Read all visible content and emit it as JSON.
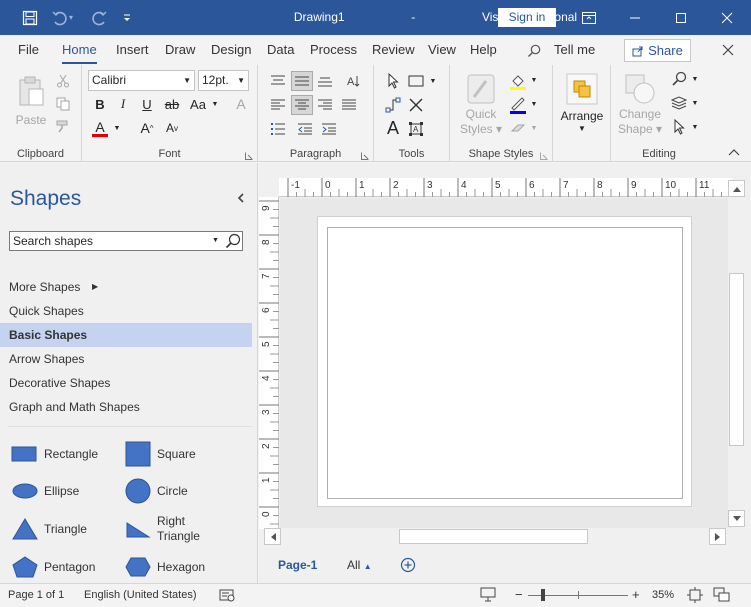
{
  "titlebar": {
    "document": "Drawing1",
    "separator": "-",
    "app": "Visio Professional",
    "sign_in": "Sign in"
  },
  "menu": {
    "tabs": [
      "File",
      "Home",
      "Insert",
      "Draw",
      "Design",
      "Data",
      "Process",
      "Review",
      "View",
      "Help"
    ],
    "active_tab": "Home",
    "tell_me": "Tell me",
    "share": "Share"
  },
  "ribbon": {
    "clipboard": {
      "paste": "Paste",
      "label": "Clipboard"
    },
    "font": {
      "family": "Calibri",
      "size": "12pt.",
      "label": "Font",
      "bold": "B",
      "italic": "I",
      "underline": "U",
      "strike": "ab",
      "case": "Aa",
      "font_color_letter": "A",
      "grow": "A",
      "shrink": "A"
    },
    "paragraph": {
      "label": "Paragraph"
    },
    "tools": {
      "label": "Tools",
      "text_tool": "A"
    },
    "shape_styles": {
      "quick_styles_1": "Quick",
      "quick_styles_2": "Styles",
      "label": "Shape Styles"
    },
    "arrange": {
      "label": "Arrange"
    },
    "editing": {
      "change_shape_1": "Change",
      "change_shape_2": "Shape",
      "label": "Editing"
    },
    "colors": {
      "fill": "#ffff00",
      "line": "#0000ff",
      "font": "#ff0000",
      "accent": "#2b579a"
    }
  },
  "shapes_panel": {
    "title": "Shapes",
    "search_placeholder": "Search shapes",
    "stencils": [
      "More Shapes",
      "Quick Shapes",
      "Basic Shapes",
      "Arrow Shapes",
      "Decorative Shapes",
      "Graph and Math Shapes"
    ],
    "selected_stencil": "Basic Shapes",
    "shapes": [
      {
        "name": "Rectangle",
        "icon": "rectangle"
      },
      {
        "name": "Square",
        "icon": "square"
      },
      {
        "name": "Ellipse",
        "icon": "ellipse"
      },
      {
        "name": "Circle",
        "icon": "circle"
      },
      {
        "name": "Triangle",
        "icon": "triangle"
      },
      {
        "name": "Right Triangle",
        "icon": "right-triangle",
        "line1": "Right",
        "line2": "Triangle"
      },
      {
        "name": "Pentagon",
        "icon": "pentagon"
      },
      {
        "name": "Hexagon",
        "icon": "hexagon"
      }
    ],
    "shape_color": "#4472c4"
  },
  "rulers": {
    "horizontal": [
      "-1",
      "0",
      "1",
      "2",
      "3",
      "4",
      "5",
      "6",
      "7",
      "8",
      "9",
      "10",
      "11"
    ],
    "vertical": [
      "9",
      "8",
      "7",
      "6",
      "5",
      "4",
      "3",
      "2",
      "1",
      "0"
    ]
  },
  "page_tabs": {
    "current": "Page-1",
    "all": "All"
  },
  "statusbar": {
    "page": "Page 1 of 1",
    "language": "English (United States)",
    "zoom": "35%"
  }
}
